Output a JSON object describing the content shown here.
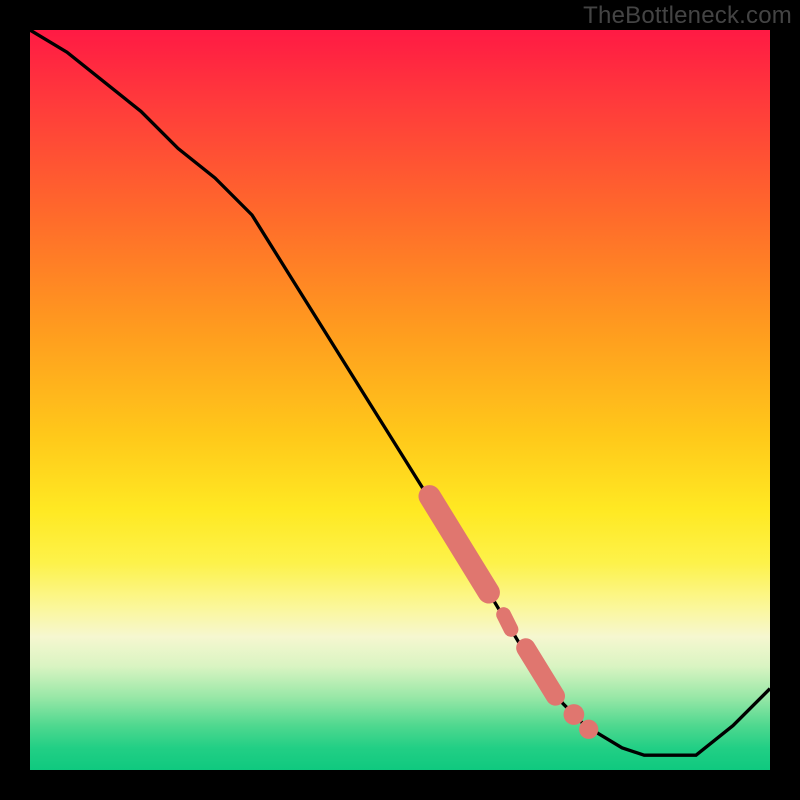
{
  "watermark": "TheBottleneck.com",
  "colors": {
    "background": "#000000",
    "curve": "#000000",
    "marker": "#e0766f"
  },
  "chart_data": {
    "type": "line",
    "title": "",
    "xlabel": "",
    "ylabel": "",
    "xlim": [
      0,
      100
    ],
    "ylim": [
      0,
      100
    ],
    "series": [
      {
        "name": "curve",
        "x": [
          0,
          5,
          10,
          15,
          20,
          25,
          30,
          35,
          40,
          45,
          50,
          55,
          60,
          62,
          65,
          68,
          70,
          72,
          75,
          80,
          83,
          85,
          90,
          95,
          100
        ],
        "y": [
          100,
          97,
          93,
          89,
          84,
          80,
          75,
          67,
          59,
          51,
          43,
          35,
          27,
          24,
          19,
          14,
          12,
          9,
          6,
          3,
          2,
          2,
          2,
          6,
          11
        ]
      }
    ],
    "markers": {
      "segments": [
        {
          "x1": 54,
          "y1": 37,
          "x2": 62,
          "y2": 24,
          "w": 3.0
        },
        {
          "x1": 64,
          "y1": 21,
          "x2": 65,
          "y2": 19,
          "w": 2.0
        },
        {
          "x1": 67,
          "y1": 16.5,
          "x2": 71,
          "y2": 10,
          "w": 2.6
        }
      ],
      "dots": [
        {
          "x": 73.5,
          "y": 7.5,
          "r": 1.4
        },
        {
          "x": 75.5,
          "y": 5.5,
          "r": 1.3
        }
      ]
    }
  }
}
